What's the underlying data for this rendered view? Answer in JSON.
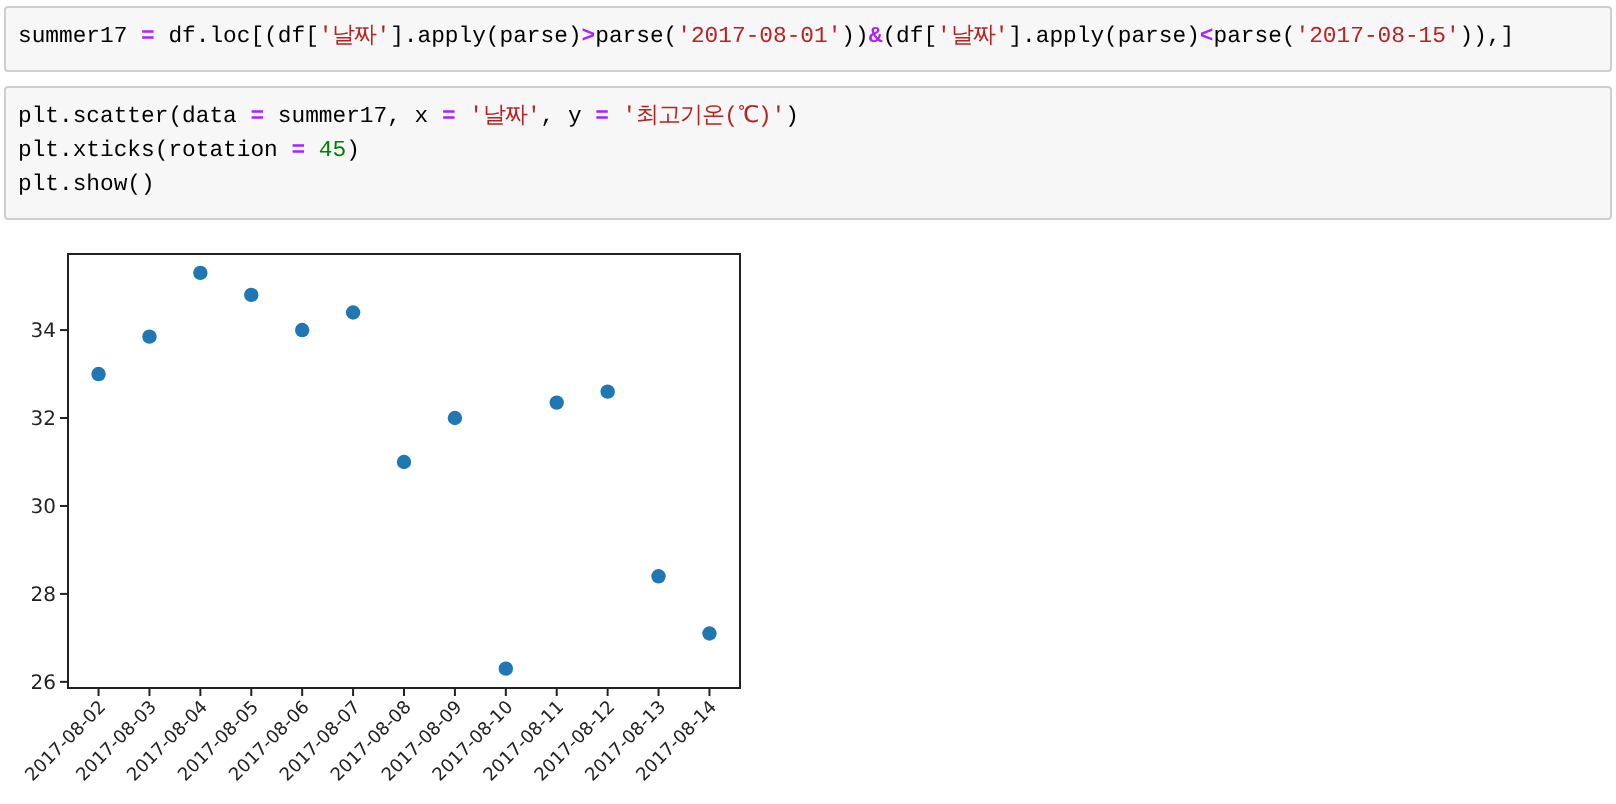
{
  "cells": [
    {
      "lines": [
        [
          {
            "kind": "plain",
            "text": "summer17 "
          },
          {
            "kind": "op",
            "text": "="
          },
          {
            "kind": "plain",
            "text": " df.loc[(df["
          },
          {
            "kind": "string",
            "text": "'날짜'"
          },
          {
            "kind": "plain",
            "text": "].apply(parse)"
          },
          {
            "kind": "op",
            "text": ">"
          },
          {
            "kind": "plain",
            "text": "parse("
          },
          {
            "kind": "string",
            "text": "'2017-08-01'"
          },
          {
            "kind": "plain",
            "text": "))"
          },
          {
            "kind": "op",
            "text": "&"
          },
          {
            "kind": "plain",
            "text": "(df["
          },
          {
            "kind": "string",
            "text": "'날짜'"
          },
          {
            "kind": "plain",
            "text": "].apply(parse)"
          },
          {
            "kind": "op",
            "text": "<"
          },
          {
            "kind": "plain",
            "text": "parse("
          },
          {
            "kind": "string",
            "text": "'2017-08-15'"
          },
          {
            "kind": "plain",
            "text": ")),]"
          }
        ]
      ]
    },
    {
      "lines": [
        [
          {
            "kind": "plain",
            "text": "plt.scatter(data "
          },
          {
            "kind": "op",
            "text": "="
          },
          {
            "kind": "plain",
            "text": " summer17, x "
          },
          {
            "kind": "op",
            "text": "= "
          },
          {
            "kind": "string",
            "text": "'날짜'"
          },
          {
            "kind": "plain",
            "text": ", y "
          },
          {
            "kind": "op",
            "text": "= "
          },
          {
            "kind": "string",
            "text": "'최고기온(℃)'"
          },
          {
            "kind": "plain",
            "text": ")"
          }
        ],
        [
          {
            "kind": "plain",
            "text": "plt.xticks(rotation "
          },
          {
            "kind": "op",
            "text": "= "
          },
          {
            "kind": "number",
            "text": "45"
          },
          {
            "kind": "plain",
            "text": ")"
          }
        ],
        [
          {
            "kind": "plain",
            "text": "plt.show()"
          }
        ]
      ]
    }
  ],
  "output": {
    "chart_data": {
      "type": "scatter",
      "x": [
        "2017-08-02",
        "2017-08-03",
        "2017-08-04",
        "2017-08-05",
        "2017-08-06",
        "2017-08-07",
        "2017-08-08",
        "2017-08-09",
        "2017-08-10",
        "2017-08-11",
        "2017-08-12",
        "2017-08-13",
        "2017-08-14"
      ],
      "series": [
        {
          "color": "#1f77b4",
          "values": [
            33.0,
            33.85,
            35.3,
            34.8,
            34.0,
            34.4,
            31.0,
            32.0,
            26.3,
            32.35,
            32.6,
            28.4,
            27.1
          ]
        }
      ],
      "ylim": [
        25.86,
        35.73
      ],
      "yticks": [
        26,
        28,
        30,
        32,
        34
      ]
    }
  }
}
